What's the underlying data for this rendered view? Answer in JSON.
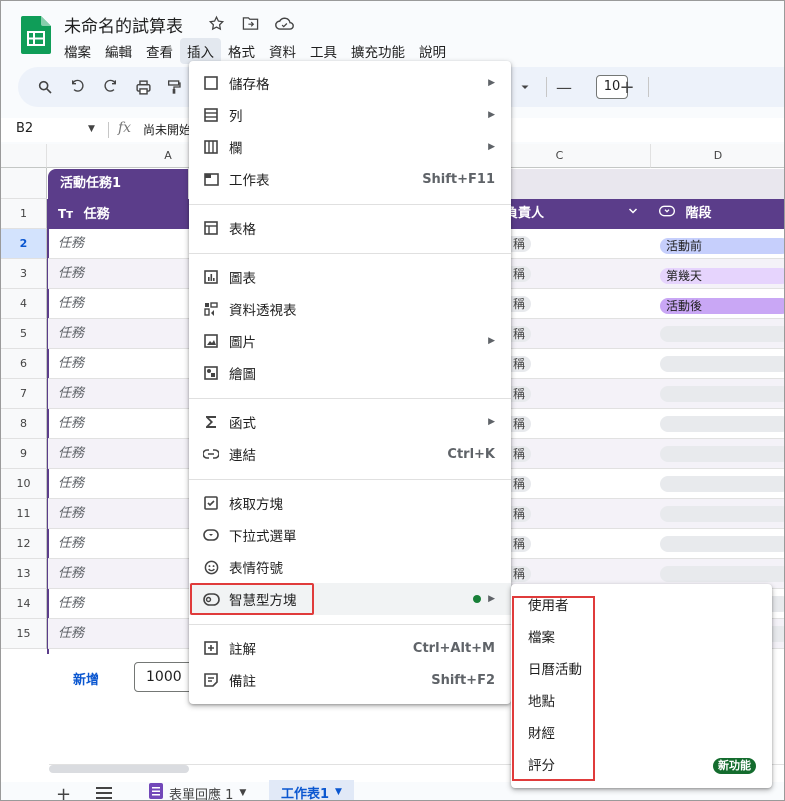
{
  "doc": {
    "title": "未命名的試算表"
  },
  "menubar": [
    "檔案",
    "編輯",
    "查看",
    "插入",
    "格式",
    "資料",
    "工具",
    "擴充功能",
    "說明"
  ],
  "toolbar": {
    "font_size": "10",
    "minus": "—",
    "plus": "+"
  },
  "formula_bar": {
    "cell_ref": "B2",
    "fx": "fx",
    "content": "尚未開始"
  },
  "columns": [
    "A",
    "C",
    "D"
  ],
  "table": {
    "title": "活動任務1",
    "header_task": "任務",
    "header_owner": "負責人",
    "header_stage": "階段",
    "task_placeholder": "任務",
    "owner_placeholder": "稱",
    "stages": [
      "活動前",
      "第幾天",
      "活動後"
    ],
    "stage_colors": [
      "#c6cffc",
      "#e6d4fd",
      "#c9a7f5"
    ]
  },
  "rows": [
    "1",
    "2",
    "3",
    "4",
    "5",
    "6",
    "7",
    "8",
    "9",
    "10",
    "11",
    "12",
    "13",
    "14",
    "15"
  ],
  "footer": {
    "add_label": "新增",
    "rows_value": "1000"
  },
  "sheets": {
    "tab1": "表單回應 1",
    "tab2": "工作表1"
  },
  "insert_menu": {
    "items": [
      {
        "label": "儲存格",
        "shortcut": "",
        "submenu": true,
        "icon": "square-icon"
      },
      {
        "label": "列",
        "shortcut": "",
        "submenu": true,
        "icon": "rows-icon"
      },
      {
        "label": "欄",
        "shortcut": "",
        "submenu": true,
        "icon": "columns-icon"
      },
      {
        "label": "工作表",
        "shortcut": "Shift+F11",
        "submenu": false,
        "icon": "sheet-icon"
      },
      {
        "label": "表格",
        "shortcut": "",
        "submenu": false,
        "icon": "table-icon"
      },
      {
        "label": "圖表",
        "shortcut": "",
        "submenu": false,
        "icon": "chart-icon"
      },
      {
        "label": "資料透視表",
        "shortcut": "",
        "submenu": false,
        "icon": "pivot-icon"
      },
      {
        "label": "圖片",
        "shortcut": "",
        "submenu": true,
        "icon": "image-icon"
      },
      {
        "label": "繪圖",
        "shortcut": "",
        "submenu": false,
        "icon": "drawing-icon"
      },
      {
        "label": "函式",
        "shortcut": "",
        "submenu": true,
        "icon": "sigma-icon"
      },
      {
        "label": "連結",
        "shortcut": "Ctrl+K",
        "submenu": false,
        "icon": "link-icon"
      },
      {
        "label": "核取方塊",
        "shortcut": "",
        "submenu": false,
        "icon": "checkbox-icon"
      },
      {
        "label": "下拉式選單",
        "shortcut": "",
        "submenu": false,
        "icon": "dropdown-icon"
      },
      {
        "label": "表情符號",
        "shortcut": "",
        "submenu": false,
        "icon": "emoji-icon"
      },
      {
        "label": "智慧型方塊",
        "shortcut": "",
        "submenu": true,
        "icon": "smart-chip-icon"
      },
      {
        "label": "註解",
        "shortcut": "Ctrl+Alt+M",
        "submenu": false,
        "icon": "comment-icon"
      },
      {
        "label": "備註",
        "shortcut": "Shift+F2",
        "submenu": false,
        "icon": "note-icon"
      }
    ]
  },
  "smart_chip_submenu": {
    "items": [
      "使用者",
      "檔案",
      "日曆活動",
      "地點",
      "財經",
      "評分"
    ],
    "new_badge": "新功能"
  }
}
